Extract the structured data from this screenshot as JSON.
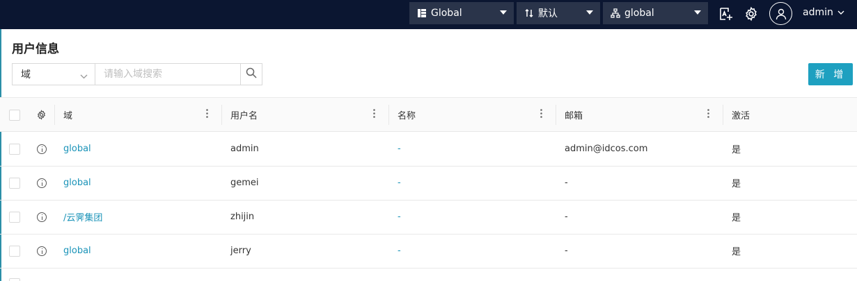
{
  "topbar": {
    "dropdowns": [
      {
        "label": "Global"
      },
      {
        "label": "默认"
      },
      {
        "label": "global"
      }
    ],
    "username": "admin"
  },
  "page": {
    "title": "用户信息"
  },
  "filter": {
    "field": "域",
    "placeholder": "请输入域搜索"
  },
  "toolbar": {
    "add_label": "新 增"
  },
  "table": {
    "columns": [
      "域",
      "用户名",
      "名称",
      "邮箱",
      "激活"
    ],
    "rows": [
      {
        "domain": "global",
        "username": "admin",
        "name": "-",
        "email": "admin@idcos.com",
        "active": "是"
      },
      {
        "domain": "global",
        "username": "gemei",
        "name": "-",
        "email": "-",
        "active": "是"
      },
      {
        "domain": "/云霁集团",
        "username": "zhijin",
        "name": "-",
        "email": "-",
        "active": "是"
      },
      {
        "domain": "global",
        "username": "jerry",
        "name": "-",
        "email": "-",
        "active": "是"
      }
    ]
  },
  "colors": {
    "topbar_bg": "#0b1631",
    "dropdown_bg": "#2a344a",
    "accent": "#1ea0c0",
    "link": "#1a93b8"
  }
}
